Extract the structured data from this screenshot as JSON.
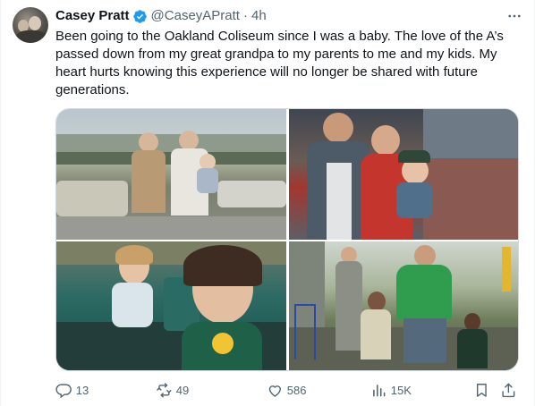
{
  "author": {
    "name": "Casey Pratt",
    "handle": "@CaseyAPratt",
    "separator": "·",
    "time": "4h"
  },
  "tweet": {
    "text": "Been going to the Oakland Coliseum since I was a baby. The love of the A’s\npassed down from my great grandpa to my parents to me and my kids. My\nheart hurts knowing this experience will no longer be shared with future\ngenerations."
  },
  "actions": {
    "replies": "13",
    "reposts": "49",
    "likes": "586",
    "views": "15K"
  },
  "icons": {
    "verified": "verified-badge-icon",
    "more": "more-icon",
    "reply": "reply-icon",
    "repost": "repost-icon",
    "like": "like-icon",
    "views": "views-icon",
    "bookmark": "bookmark-icon",
    "share": "share-icon"
  },
  "colors": {
    "verified": "#1d9bf0",
    "text": "#0f1419",
    "secondary": "#536471",
    "border": "#cfd9de"
  }
}
